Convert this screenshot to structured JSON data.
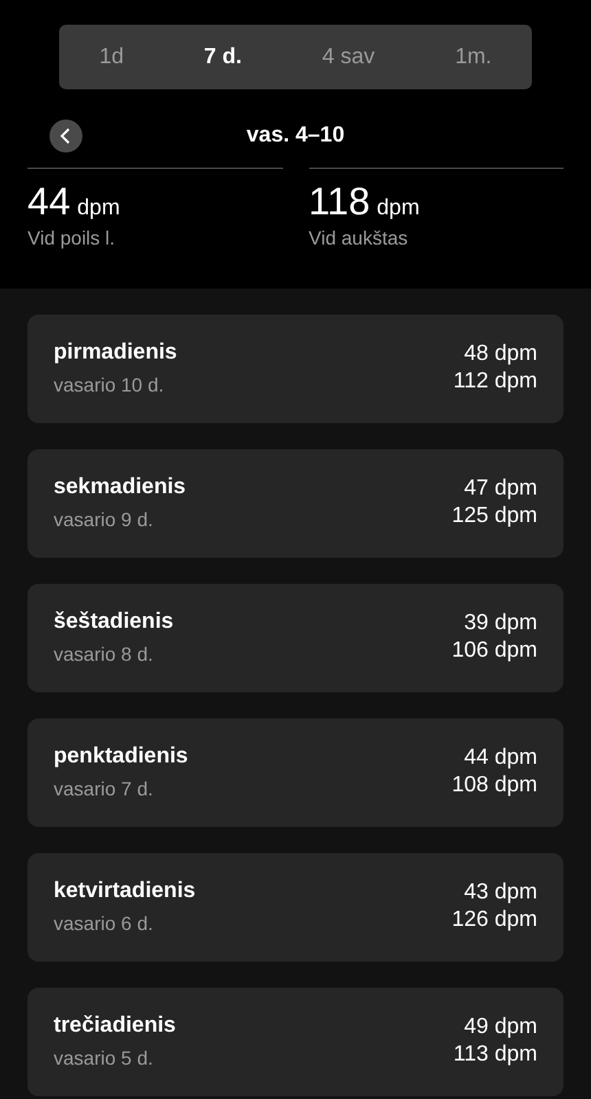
{
  "tabs": [
    {
      "label": "1d",
      "selected": false
    },
    {
      "label": "7 d.",
      "selected": true
    },
    {
      "label": "4 sav",
      "selected": false
    },
    {
      "label": "1m.",
      "selected": false
    }
  ],
  "period": {
    "title": "vas. 4–10"
  },
  "stats": [
    {
      "value": "44",
      "unit": "dpm",
      "label": "Vid poils l."
    },
    {
      "value": "118",
      "unit": "dpm",
      "label": "Vid aukštas"
    }
  ],
  "days": [
    {
      "name": "pirmadienis",
      "date": "vasario 10 d.",
      "resting": "48 dpm",
      "high": "112 dpm"
    },
    {
      "name": "sekmadienis",
      "date": "vasario 9 d.",
      "resting": "47 dpm",
      "high": "125 dpm"
    },
    {
      "name": "šeštadienis",
      "date": "vasario 8 d.",
      "resting": "39 dpm",
      "high": "106 dpm"
    },
    {
      "name": "penktadienis",
      "date": "vasario 7 d.",
      "resting": "44 dpm",
      "high": "108 dpm"
    },
    {
      "name": "ketvirtadienis",
      "date": "vasario 6 d.",
      "resting": "43 dpm",
      "high": "126 dpm"
    },
    {
      "name": "trečiadienis",
      "date": "vasario 5 d.",
      "resting": "49 dpm",
      "high": "113 dpm"
    }
  ]
}
